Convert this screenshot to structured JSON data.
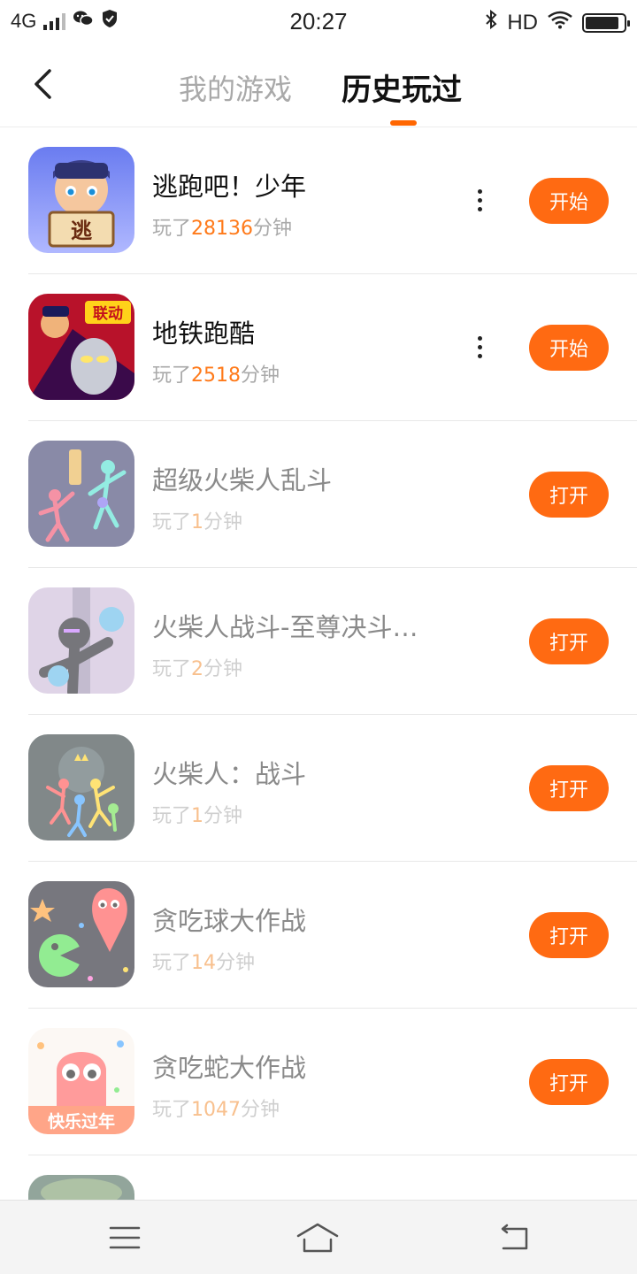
{
  "status_bar": {
    "network": "4G",
    "time": "20:27",
    "hd": "HD"
  },
  "header": {
    "tabs": [
      {
        "label": "我的游戏",
        "active": false
      },
      {
        "label": "历史玩过",
        "active": true
      }
    ]
  },
  "colors": {
    "accent": "#ff6a12",
    "minutes_highlight": "#ff7a1a"
  },
  "games": [
    {
      "title": "逃跑吧！少年",
      "played_prefix": "玩了",
      "minutes": "28136",
      "played_suffix": "分钟",
      "action": "开始",
      "has_more_menu": true,
      "icon": "escape-boy-game-icon"
    },
    {
      "title": "地铁跑酷",
      "played_prefix": "玩了",
      "minutes": "2518",
      "played_suffix": "分钟",
      "action": "开始",
      "has_more_menu": true,
      "icon": "subway-surf-game-icon",
      "icon_badge": "联动"
    },
    {
      "title": "超级火柴人乱斗",
      "played_prefix": "玩了",
      "minutes": "1",
      "played_suffix": "分钟",
      "action": "打开",
      "has_more_menu": false,
      "icon": "stickman-brawl-game-icon"
    },
    {
      "title": "火柴人战斗-至尊决斗…",
      "played_prefix": "玩了",
      "minutes": "2",
      "played_suffix": "分钟",
      "action": "打开",
      "has_more_menu": false,
      "icon": "stickman-duel-game-icon"
    },
    {
      "title": "火柴人：战斗",
      "played_prefix": "玩了",
      "minutes": "1",
      "played_suffix": "分钟",
      "action": "打开",
      "has_more_menu": false,
      "icon": "stickman-fight-game-icon"
    },
    {
      "title": "贪吃球大作战",
      "played_prefix": "玩了",
      "minutes": "14",
      "played_suffix": "分钟",
      "action": "打开",
      "has_more_menu": false,
      "icon": "ball-battle-game-icon"
    },
    {
      "title": "贪吃蛇大作战",
      "played_prefix": "玩了",
      "minutes": "1047",
      "played_suffix": "分钟",
      "action": "打开",
      "has_more_menu": false,
      "icon": "snake-battle-game-icon",
      "icon_badge": "快乐过年"
    }
  ],
  "bottom_nav": {
    "items": [
      "menu-icon",
      "home-icon",
      "back-icon"
    ]
  }
}
